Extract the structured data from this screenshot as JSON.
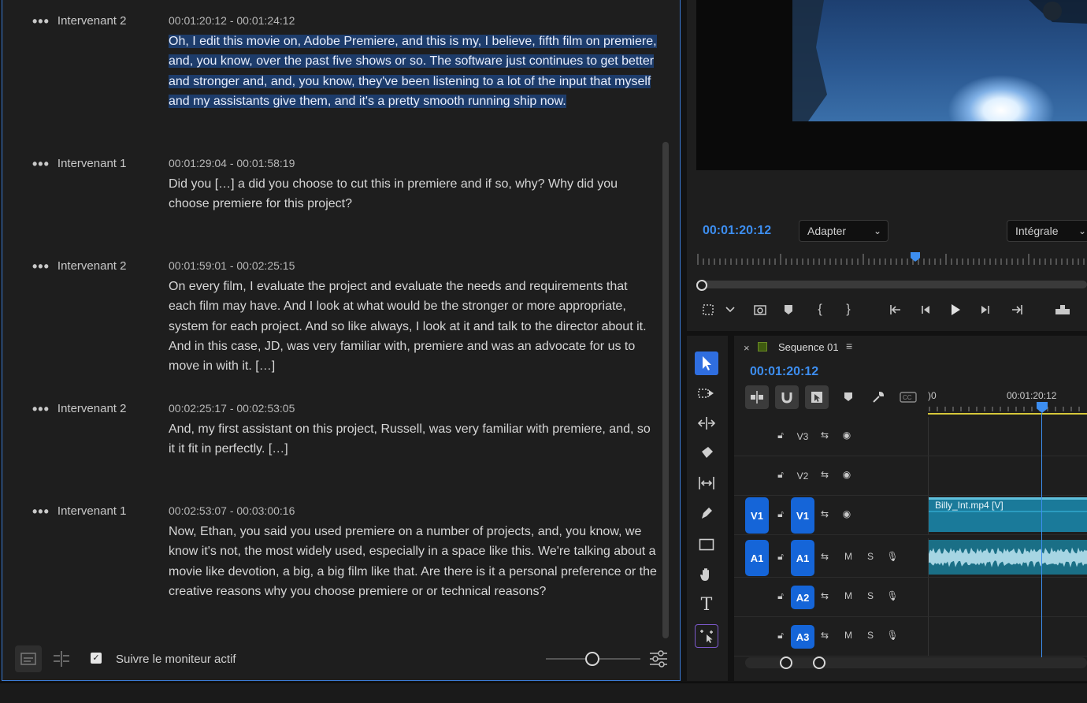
{
  "transcript": {
    "entries": [
      {
        "speaker": "Intervenant 2",
        "timecode": "00:01:20:12 - 00:01:24:12",
        "text": "Oh, I edit this movie on, Adobe Premiere, and this is my, I believe, fifth film on premiere, and, you know, over the past five shows or so. The software just continues to get better and stronger and, and, you know, they've been listening to a lot of the input that myself and my assistants give them, and it's a pretty smooth running ship now."
      },
      {
        "speaker": "Intervenant 1",
        "timecode": "00:01:29:04 - 00:01:58:19",
        "text": "Did you […] a did you choose to cut this in premiere and if so, why? Why did you choose premiere for this project?"
      },
      {
        "speaker": "Intervenant 2",
        "timecode": "00:01:59:01 - 00:02:25:15",
        "text": "On every film, I evaluate the project and evaluate the needs and requirements that each film may have. And I look at what would be the stronger or more appropriate, system for each project. And so like always, I look at it and talk to the director about it. And in this case, JD, was very familiar with, premiere and was an advocate for us to move in with it. […]"
      },
      {
        "speaker": "Intervenant 2",
        "timecode": "00:02:25:17 - 00:02:53:05",
        "text": "And, my first assistant on this project, Russell, was very familiar with premiere, and, so it it fit in perfectly. […]"
      },
      {
        "speaker": "Intervenant 1",
        "timecode": "00:02:53:07 - 00:03:00:16",
        "text": "Now, Ethan, you said you used premiere on a number of projects, and, you know, we know it's not, the most widely used, especially in a space like this. We're talking about a movie like devotion, a big, a big film like that. Are there is it a personal preference or the creative reasons why you choose premiere or or technical reasons?"
      }
    ],
    "footer": {
      "follow_label": "Suivre le moniteur actif",
      "follow_checked": true,
      "zoom_level": 0.5
    }
  },
  "monitor": {
    "timecode": "00:01:20:12",
    "fit_option": "Adapter",
    "resolution_option": "Intégrale"
  },
  "timeline": {
    "sequence_name": "Sequence 01",
    "timecode": "00:01:20:12",
    "ruler_start_label": ")0",
    "ruler_playhead_label": "00:01:20:12",
    "tracks": [
      {
        "name": "V3",
        "type": "video"
      },
      {
        "name": "V2",
        "type": "video"
      },
      {
        "name": "V1",
        "type": "video",
        "source": "V1",
        "clip": "Billy_Int.mp4 [V]"
      },
      {
        "name": "A1",
        "type": "audio",
        "source": "A1",
        "m": "M",
        "s": "S"
      },
      {
        "name": "A2",
        "type": "audio",
        "m": "M",
        "s": "S"
      },
      {
        "name": "A3",
        "type": "audio",
        "m": "M",
        "s": "S"
      }
    ]
  },
  "colors": {
    "accent_blue": "#3d8ef0",
    "selection": "#1d3c6b",
    "track_target": "#1565d8",
    "clip": "#1a7a9a"
  }
}
